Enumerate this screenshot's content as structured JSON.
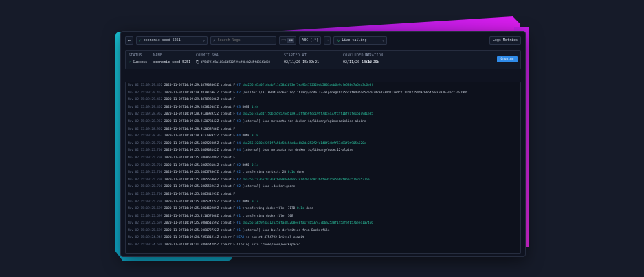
{
  "colors": {
    "background": "#161b29",
    "panel": "#0f1320",
    "accent_blue": "#2f8be8",
    "success_green": "#2bb673",
    "log_highlight": "#2bc4a0",
    "step_blue": "#3b8be0",
    "decor_magenta": "#e21df0",
    "decor_cyan": "#19c3d6"
  },
  "toolbar": {
    "back_icon": "arrow-left-icon",
    "seed_check_icon": "check-icon",
    "seed_select": "economic-seed-5251",
    "search_placeholder": "Search logs",
    "toggle_off": "⟺",
    "toggle_on": "▪▪",
    "abc_label": "ABC (.*)",
    "next_label": "→",
    "live_label": "Live tailing",
    "logs_metrics_label": "Logs Metrics"
  },
  "summary": {
    "status_label": "STATUS",
    "status_value": "Success",
    "name_label": "NAME",
    "name_value": "economic-seed-5251",
    "sha_label": "COMMIT SHA",
    "sha_value": "d754791f5a188e6d530729ef0b4b2d5f48541d58",
    "started_label": "STARTED AT",
    "started_value": "02/11/20 15:09:21",
    "concluded_label": "CONCLUDED AT",
    "concluded_value": "02/11/20 15:12:58",
    "duration_label": "DURATION",
    "duration_value": "03m 29s",
    "ongoing_label": "Ongoing"
  },
  "logs": [
    {
      "time": "Nov 02 15:09:29.452",
      "ts": "2020-11-02T14:09:29.487908063Z",
      "stream": "stdout F",
      "step": "#7",
      "msg": "",
      "hl": "sha256:d7a0f1dcab711c58a2b73ef5ea914172320db5803aeb6e9dfe538e7a6ea3c6e8f",
      "hlclass": "hl"
    },
    {
      "time": "Nov 02 15:09:29.452",
      "ts": "2020-11-02T14:09:29.487916967Z",
      "stream": "stdout F",
      "step": "#7",
      "msg": "[builder 1/8] FROM docker.io/library/node:12-alpine@sha256:9f8d0fde57ef02d73d234d712edc2111d12354d9cb6542dc8383b7eacf7d9199f",
      "hl": "",
      "hlclass": "hl"
    },
    {
      "time": "Nov 02 15:09:29.452",
      "ts": "2020-11-02T14:09:29.487893606Z",
      "stream": "stdout F",
      "step": "",
      "msg": "",
      "hl": "",
      "hlclass": "hl"
    },
    {
      "time": "Nov 02 15:09:29.452",
      "ts": "2020-11-02T14:09:29.285815087Z",
      "stream": "stdout F",
      "step": "#3",
      "msg": "DONE",
      "hl": "1.4s",
      "hlclass": "hl"
    },
    {
      "time": "Nov 02 15:09:28.952",
      "ts": "2020-11-02T14:09:28.912098922Z",
      "stream": "stdout F",
      "step": "#3",
      "msg": "",
      "hl": "sha256:cd2d4f756bcb5957bd51a913aff859fdc19ff7dc4d37fcff1bf7afe1b1c9d1e85",
      "hlclass": "hl"
    },
    {
      "time": "Nov 02 15:09:28.952",
      "ts": "2020-11-02T14:09:28.912078442Z",
      "stream": "stdout F",
      "step": "#3",
      "msg": "[internal] load metadata for docker.io/library/nginx:mainline-alpine",
      "hl": "",
      "hlclass": "hl"
    },
    {
      "time": "Nov 02 15:09:28.952",
      "ts": "2020-11-02T14:09:28.912058786Z",
      "stream": "stdout F",
      "step": "",
      "msg": "",
      "hl": "",
      "hlclass": "hl"
    },
    {
      "time": "Nov 02 15:09:28.952",
      "ts": "2020-11-02T14:09:28.912798922Z",
      "stream": "stdout F",
      "step": "#4",
      "msg": "DONE",
      "hl": "3.3s",
      "hlclass": "hl"
    },
    {
      "time": "Nov 02 15:09:25.700",
      "ts": "2020-11-02T14:09:25.680922885Z",
      "stream": "stdout F",
      "step": "#4",
      "msg": "",
      "hl": "sha256:2280e2291f7a56e58e54a4ae6b2dc252f2fa148f24bff57e81f0f905a520e",
      "hlclass": "hl"
    },
    {
      "time": "Nov 02 15:09:25.700",
      "ts": "2020-11-02T14:09:25.680908142Z",
      "stream": "stdout F",
      "step": "#4",
      "msg": "[internal] load metadata for docker.io/library/node:12-alpine",
      "hl": "",
      "hlclass": "hl"
    },
    {
      "time": "Nov 02 15:09:25.700",
      "ts": "2020-11-02T14:09:25.680865789Z",
      "stream": "stdout F",
      "step": "",
      "msg": "",
      "hl": "",
      "hlclass": "hl"
    },
    {
      "time": "Nov 02 15:09:25.700",
      "ts": "2020-11-02T14:09:25.680598184Z",
      "stream": "stdout F",
      "step": "#2",
      "msg": "DONE",
      "hl": "0.1s",
      "hlclass": "hl"
    },
    {
      "time": "Nov 02 15:09:25.700",
      "ts": "2020-11-02T14:09:25.680578807Z",
      "stream": "stdout F",
      "step": "#2",
      "msg": "transferring context: 2B",
      "hl": "0.1s",
      "hlclass": "hl",
      "suffix": "done"
    },
    {
      "time": "Nov 02 15:09:25.700",
      "ts": "2020-11-02T14:09:25.680556468Z",
      "stream": "stdout F",
      "step": "#2",
      "msg": "",
      "hl": "sha256:f4265f91269fbe898ebe9a52e1d2ba1d9c3b4fe9f45e5eb9f0ba1516265216a",
      "hlclass": "hl"
    },
    {
      "time": "Nov 02 15:09:25.700",
      "ts": "2020-11-02T14:09:25.680553261Z",
      "stream": "stdout F",
      "step": "#2",
      "msg": "[internal] load .dockerignore",
      "hl": "",
      "hlclass": "hl"
    },
    {
      "time": "Nov 02 15:09:25.700",
      "ts": "2020-11-02T14:09:25.680541293Z",
      "stream": "stdout F",
      "step": "",
      "msg": "",
      "hl": "",
      "hlclass": "hl"
    },
    {
      "time": "Nov 02 15:09:25.700",
      "ts": "2020-11-02T14:09:25.680524224Z",
      "stream": "stdout F",
      "step": "#1",
      "msg": "DONE",
      "hl": "0.1s",
      "hlclass": "hl"
    },
    {
      "time": "Nov 02 15:09:25.699",
      "ts": "2020-11-02T14:09:25.680460289Z",
      "stream": "stdout F",
      "step": "#1",
      "msg": "transferring dockerfile: 717B",
      "hl": "0.1s",
      "hlclass": "hl",
      "suffix": "done"
    },
    {
      "time": "Nov 02 15:09:25.699",
      "ts": "2020-11-02T14:09:25.511057608Z",
      "stream": "stdout F",
      "step": "#1",
      "msg": "transferring dockerfile: 30B",
      "hl": "",
      "hlclass": "hl"
    },
    {
      "time": "Nov 02 15:09:25.699",
      "ts": "2020-11-02T14:09:25.508051659Z",
      "stream": "stdout F",
      "step": "#1",
      "msg": "",
      "hl": "sha256:a659f4a1126258fa487268ec0fa1f4b537437b6a25a8f1f5afefb576eed1a7466",
      "hlclass": "hl"
    },
    {
      "time": "Nov 02 15:09:25.699",
      "ts": "2020-11-02T14:09:25.508072722Z",
      "stream": "stdout F",
      "step": "#1",
      "msg": "[internal] load build definition from Dockerfile",
      "hl": "",
      "hlclass": "hl"
    },
    {
      "time": "Nov 02 15:09:24.949",
      "ts": "2020-11-02T14:09:24.735181214Z",
      "stream": "stderr F",
      "step": "",
      "msg": "HEAD is now at d754792 Initial commit",
      "hl": "",
      "hlclass": "hl",
      "stepword": "HEAD"
    },
    {
      "time": "Nov 02 15:09:24.699",
      "ts": "2020-11-02T14:09:21.589664285Z",
      "stream": "stderr F",
      "step": "",
      "msg": "Cloning into '/home/node/workspace'...",
      "hl": "",
      "hlclass": "hl"
    }
  ]
}
